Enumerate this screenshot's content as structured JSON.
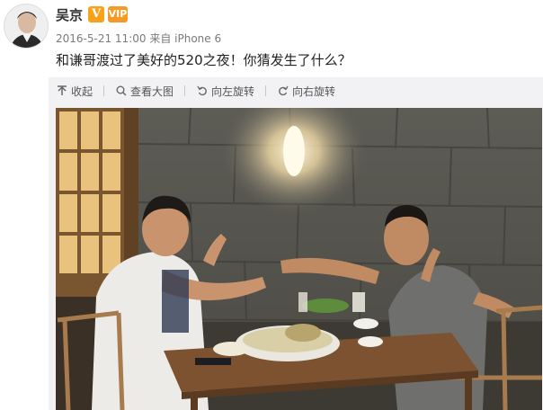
{
  "post": {
    "username": "吴京",
    "verified_mark": "V",
    "vip_mark": "VIP",
    "timestamp": "2016-5-21 11:00",
    "source": "来自 iPhone 6",
    "text": "和谦哥渡过了美好的520之夜！你猜发生了什么？"
  },
  "toolbar": {
    "collapse_label": "收起",
    "view_large_label": "查看大图",
    "rotate_left_label": "向左旋转",
    "rotate_right_label": "向右旋转"
  },
  "colors": {
    "badge_orange": "#f7a21a",
    "panel_bg": "#f2f2f5",
    "text_gray": "#7a7a7a"
  }
}
